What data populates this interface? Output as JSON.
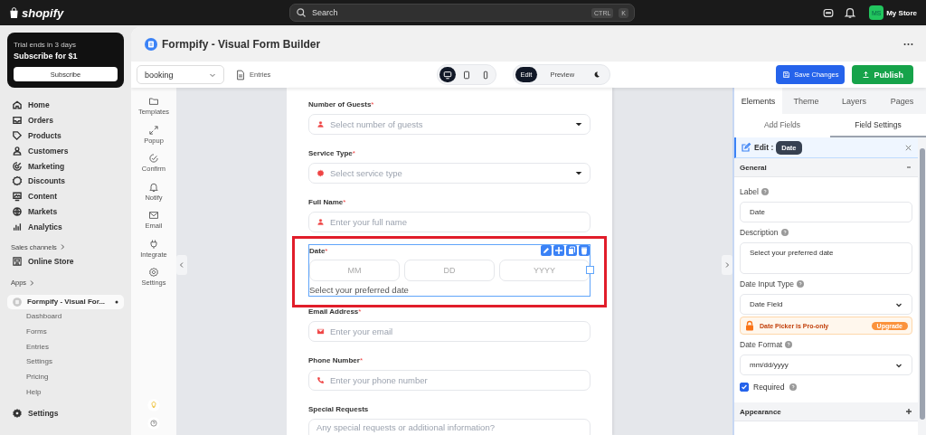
{
  "topbar": {
    "logo": "shopify",
    "search": "Search",
    "keys": [
      "CTRL",
      "K"
    ],
    "avatar": "MS",
    "store": "My Store"
  },
  "nav": {
    "trial": {
      "title": "Trial ends in 3 days",
      "offer": "Subscribe for $1",
      "button": "Subscribe"
    },
    "items": [
      {
        "label": "Home"
      },
      {
        "label": "Orders"
      },
      {
        "label": "Products"
      },
      {
        "label": "Customers"
      },
      {
        "label": "Marketing"
      },
      {
        "label": "Discounts"
      },
      {
        "label": "Content"
      },
      {
        "label": "Markets"
      },
      {
        "label": "Analytics"
      }
    ],
    "sales_channels": "Sales channels",
    "online_store": "Online Store",
    "apps": "Apps",
    "app": {
      "label": "Formpify - Visual For...",
      "subitems": [
        "Dashboard",
        "Forms",
        "Entries",
        "Settings",
        "Pricing",
        "Help"
      ]
    },
    "settings": "Settings"
  },
  "app": {
    "title": "Formpify - Visual Form Builder",
    "form_select": "booking",
    "entries": "Entries",
    "devices": [
      {
        "kind": "desktop",
        "selected": true
      },
      {
        "kind": "tablet",
        "selected": false
      },
      {
        "kind": "mobile",
        "selected": false
      }
    ],
    "modes": [
      {
        "label": "Edit",
        "selected": true
      },
      {
        "label": "Preview",
        "selected": false
      }
    ],
    "save": "Save Changes",
    "publish": "Publish"
  },
  "tools": [
    "Templates",
    "Popup",
    "Confirm",
    "Notify",
    "Email",
    "Integrate",
    "Settings"
  ],
  "form": {
    "fields": [
      {
        "kind": "select",
        "label": "Number of Guests",
        "required_mark": "*",
        "placeholder": "Select number of guests",
        "selected": false
      },
      {
        "kind": "select",
        "label": "Service Type",
        "required_mark": "*",
        "placeholder": "Select service type",
        "selected": false
      },
      {
        "kind": "text",
        "label": "Full Name",
        "required_mark": "*",
        "placeholder": "Enter your full name",
        "selected": false
      },
      {
        "kind": "date",
        "label": "Date",
        "required_mark": "*",
        "parts": [
          "MM",
          "DD",
          "YYYY"
        ],
        "description": "Select your preferred date",
        "selected": true
      },
      {
        "kind": "text",
        "label": "Email Address",
        "required_mark": "*",
        "placeholder": "Enter your email",
        "selected": false
      },
      {
        "kind": "text",
        "label": "Phone Number",
        "required_mark": "*",
        "placeholder": "Enter your phone number",
        "selected": false
      },
      {
        "kind": "textarea",
        "label": "Special Requests",
        "placeholder": "Any special requests or additional information?",
        "selected": false
      }
    ]
  },
  "panel": {
    "tabs": [
      {
        "label": "Elements",
        "selected": true
      },
      {
        "label": "Theme",
        "selected": false
      },
      {
        "label": "Layers",
        "selected": false
      },
      {
        "label": "Pages",
        "selected": false
      }
    ],
    "subtabs": [
      {
        "label": "Add Fields",
        "selected": false
      },
      {
        "label": "Field Settings",
        "selected": true
      }
    ],
    "edit_label": "Edit :",
    "edit_chip": "Date",
    "general": {
      "title": "General",
      "expanded": true
    },
    "label_label": "Label",
    "label_value": "Date",
    "description_label": "Description",
    "description_value": "Select your preferred date",
    "input_type_label": "Date Input Type",
    "input_type_value": "Date Field",
    "pro_notice": "Date Picker is Pro-only",
    "upgrade": "Upgrade",
    "format_label": "Date Format",
    "format_value": "mm/dd/yyyy",
    "required_label": "Required",
    "required": true,
    "appearance": {
      "title": "Appearance",
      "expanded": false
    }
  }
}
